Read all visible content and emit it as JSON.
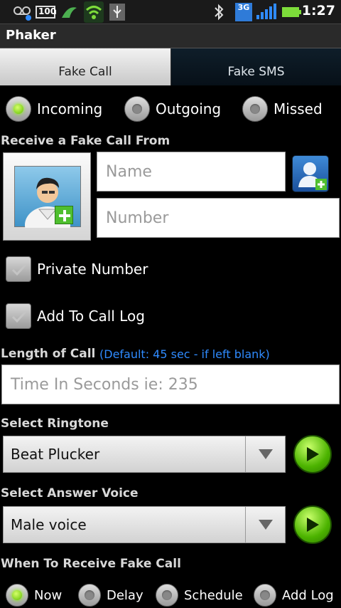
{
  "status_bar": {
    "battery_pct": "100",
    "network": "3G",
    "time": "1:27"
  },
  "app": {
    "title": "Phaker"
  },
  "tabs": [
    {
      "label": "Fake Call",
      "active": true
    },
    {
      "label": "Fake SMS",
      "active": false
    }
  ],
  "call_type": {
    "options": [
      "Incoming",
      "Outgoing",
      "Missed"
    ],
    "selected": "Incoming"
  },
  "receive_from": {
    "label": "Receive a Fake Call From",
    "name_placeholder": "Name",
    "number_placeholder": "Number"
  },
  "options": {
    "private_number": "Private Number",
    "add_to_call_log": "Add To Call Log"
  },
  "length": {
    "label": "Length of Call",
    "hint": "(Default: 45 sec - if left blank)",
    "placeholder": "Time In Seconds ie: 235"
  },
  "ringtone": {
    "label": "Select Ringtone",
    "selected": "Beat Plucker"
  },
  "answer_voice": {
    "label": "Select Answer Voice",
    "selected": "Male voice"
  },
  "when": {
    "label": "When To Receive Fake Call",
    "options": [
      "Now",
      "Delay",
      "Schedule",
      "Add Log"
    ],
    "selected": "Now"
  },
  "colors": {
    "accent_green": "#5fbf00",
    "hint_blue": "#2f8bff"
  }
}
